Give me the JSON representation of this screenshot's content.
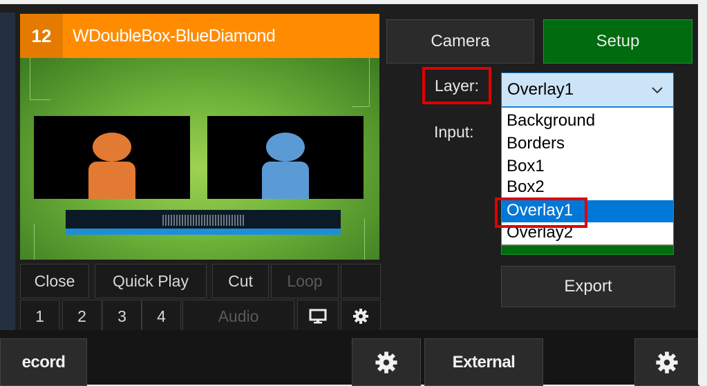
{
  "input": {
    "number": "12",
    "title": "WDoubleBox-BlueDiamond"
  },
  "input_controls": {
    "row1": [
      "Close",
      "Quick Play",
      "Cut",
      "Loop"
    ],
    "row2": [
      "1",
      "2",
      "3",
      "4"
    ],
    "audio_label": "Audio"
  },
  "buttons": {
    "camera": "Camera",
    "setup": "Setup",
    "export": "Export"
  },
  "layer_label": "Layer:",
  "input_label": "Input:",
  "layer_select": {
    "selected": "Overlay1",
    "options": [
      "Background",
      "Borders",
      "Box1",
      "Box2",
      "Overlay1",
      "Overlay2"
    ],
    "highlighted": "Overlay1"
  },
  "bottom_bar": {
    "record": "ecord",
    "external": "External"
  },
  "icons": {
    "monitor": "monitor-icon",
    "gear": "gear-icon",
    "chevron": "chevron-down-icon"
  },
  "colors": {
    "title_bar": "#ff8c00",
    "setup_green": "#006b0f",
    "selection_blue": "#0078d7",
    "annotation_red": "#e00000"
  }
}
